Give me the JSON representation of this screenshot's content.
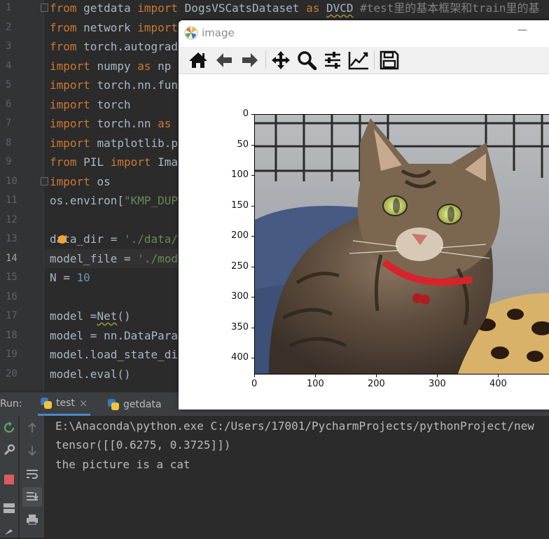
{
  "editor": {
    "line_numbers": [
      "1",
      "2",
      "3",
      "4",
      "5",
      "6",
      "7",
      "8",
      "9",
      "10",
      "11",
      "12",
      "13",
      "14",
      "15",
      "16",
      "17",
      "18",
      "19",
      "20"
    ],
    "lines": [
      [
        [
          "kw",
          "from "
        ],
        [
          "",
          "getdata "
        ],
        [
          "kw",
          "import "
        ],
        [
          "",
          "DogsVSCatsDataset "
        ],
        [
          "kw",
          "as "
        ],
        [
          "u",
          "DVCD"
        ],
        [
          "cmt",
          " #test里的基本框架和train里的基"
        ]
      ],
      [
        [
          "kw",
          "from "
        ],
        [
          "",
          "network "
        ],
        [
          "kw",
          "import"
        ]
      ],
      [
        [
          "kw",
          "from "
        ],
        [
          "",
          "torch.autograd"
        ]
      ],
      [
        [
          "kw",
          "import "
        ],
        [
          "",
          "numpy "
        ],
        [
          "kw",
          "as "
        ],
        [
          "",
          "np"
        ]
      ],
      [
        [
          "kw",
          "import "
        ],
        [
          "",
          "torch.nn.fun"
        ]
      ],
      [
        [
          "kw",
          "import "
        ],
        [
          "",
          "torch"
        ]
      ],
      [
        [
          "kw",
          "import "
        ],
        [
          "",
          "torch.nn "
        ],
        [
          "kw",
          "as"
        ]
      ],
      [
        [
          "kw",
          "import "
        ],
        [
          "",
          "matplotlib.p"
        ]
      ],
      [
        [
          "kw",
          "from "
        ],
        [
          "",
          "PIL "
        ],
        [
          "kw",
          "import "
        ],
        [
          "",
          "Ima"
        ]
      ],
      [
        [
          "kw",
          "import "
        ],
        [
          "",
          "os"
        ]
      ],
      [
        [
          "",
          "os.environ["
        ],
        [
          "str",
          "\"KMP_DUP"
        ]
      ],
      [],
      [
        [
          "",
          "data_dir = "
        ],
        [
          "str",
          "'./data/"
        ]
      ],
      [
        [
          "",
          "model_file = "
        ],
        [
          "str",
          "'./mod"
        ]
      ],
      [
        [
          "",
          "N = "
        ],
        [
          "num",
          "10"
        ]
      ],
      [],
      [
        [
          "",
          "model ="
        ],
        [
          "u",
          "Net"
        ],
        [
          "",
          "()"
        ]
      ],
      [
        [
          "",
          "model = nn.DataPara"
        ]
      ],
      [
        [
          "",
          "model.load_state_di"
        ]
      ],
      [
        [
          "",
          "model.eval()"
        ]
      ]
    ]
  },
  "run": {
    "label": "Run:",
    "tabs": [
      {
        "label": "test",
        "close": "×",
        "active": true
      },
      {
        "label": "getdata",
        "close": "×",
        "active": false
      }
    ],
    "console": [
      "E:\\Anaconda\\python.exe C:/Users/17001/PycharmProjects/pythonProject/new",
      "tensor([[0.6275, 0.3725]])",
      "the picture is a cat"
    ]
  },
  "figure": {
    "title": "image",
    "minimize": "—",
    "toolbar": [
      "home-icon",
      "back-arrow-icon",
      "forward-arrow-icon",
      "pan-icon",
      "zoom-icon",
      "configure-subplots-icon",
      "edit-axis-icon",
      "save-icon"
    ],
    "y_ticks": [
      "0",
      "50",
      "100",
      "150",
      "200",
      "250",
      "300",
      "350",
      "400"
    ],
    "x_ticks": [
      "0",
      "100",
      "200",
      "300",
      "400"
    ],
    "image_desc": "tabby-cat-photo"
  },
  "colors": {
    "editor_bg": "#2b2b2b",
    "keyword": "#cc7832",
    "string": "#6a8759",
    "number": "#6897bb",
    "comment": "#808080",
    "text": "#a9b7c6"
  }
}
